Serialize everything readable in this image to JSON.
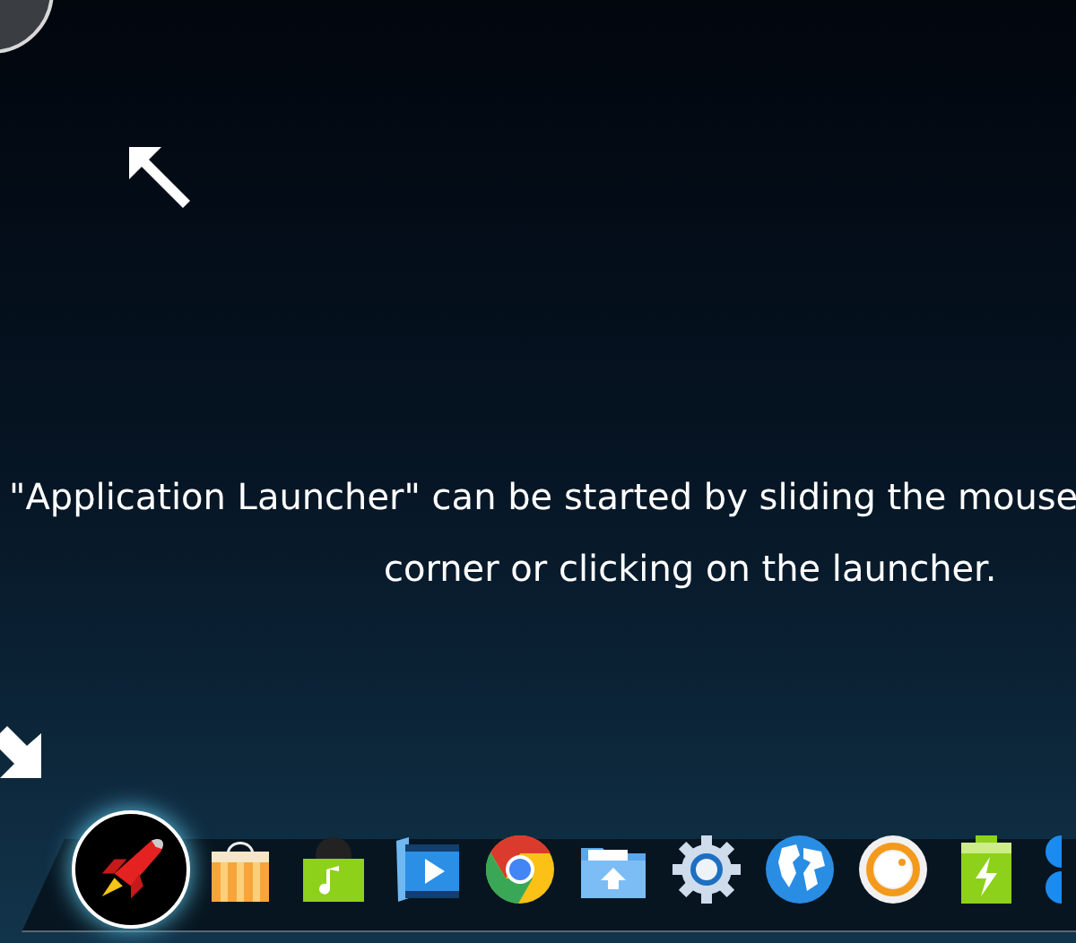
{
  "tip": {
    "lines": [
      "\"Application Launcher\" can be started by sliding the mouse",
      "corner or clicking on the launcher."
    ]
  },
  "dock": {
    "items": [
      {
        "kind": "launcher",
        "selected": true
      },
      {
        "kind": "store",
        "selected": false
      },
      {
        "kind": "music",
        "selected": false
      },
      {
        "kind": "video",
        "selected": false
      },
      {
        "kind": "browser",
        "selected": false
      },
      {
        "kind": "folder",
        "selected": false
      },
      {
        "kind": "settings",
        "selected": false
      },
      {
        "kind": "globe",
        "selected": false
      },
      {
        "kind": "knob",
        "selected": false
      },
      {
        "kind": "battery",
        "selected": false
      },
      {
        "kind": "partial",
        "selected": false
      }
    ]
  }
}
